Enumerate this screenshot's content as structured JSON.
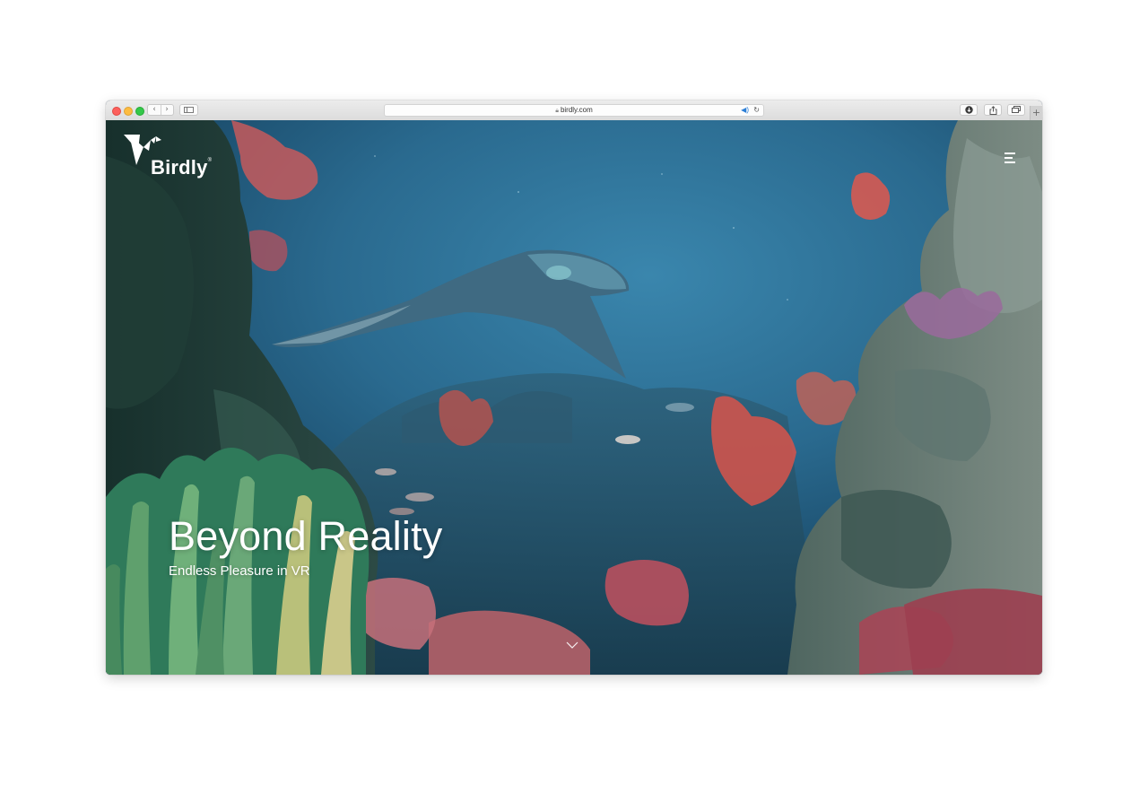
{
  "browser": {
    "url": "birdly.com",
    "nav_back": "‹",
    "nav_forward": "›",
    "reload_glyph": "↻",
    "new_tab_glyph": "+"
  },
  "site": {
    "brand": "Birdly",
    "brand_mark": "®"
  },
  "hero": {
    "title": "Beyond Reality",
    "subtitle": "Endless Pleasure in VR"
  },
  "icons": {
    "menu": "hamburger-menu-icon",
    "scroll": "chevron-down-icon",
    "download": "download-icon",
    "share": "share-icon",
    "tabs": "tabs-overview-icon",
    "lock": "lock-icon",
    "audio": "speaker-icon"
  },
  "colors": {
    "water_deep": "#0f3550",
    "water_mid": "#2a6a8f",
    "coral_red": "#d8544a",
    "kelp_green": "#5fa06d",
    "accent_link": "#2d7fd6"
  }
}
